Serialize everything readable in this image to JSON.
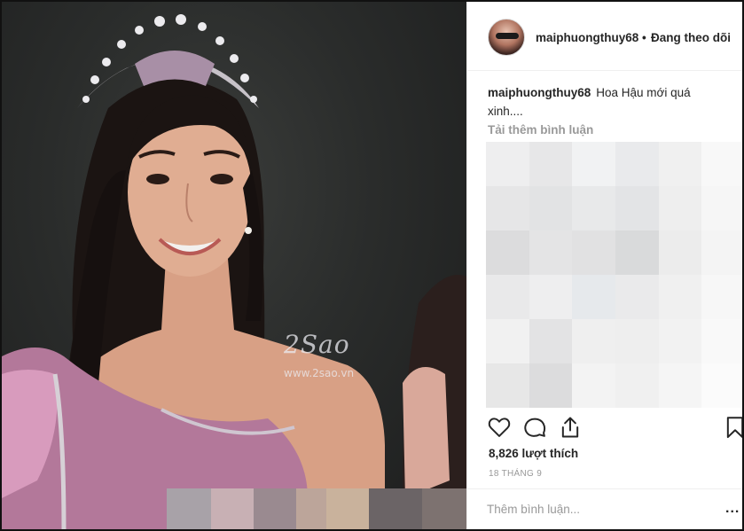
{
  "post": {
    "watermark_logo": "2Sao",
    "watermark_url": "www.2sao.vn",
    "image_censor_colors": [
      "#a8a2a8",
      "#c8b0b4",
      "#9a8a90",
      "#bca59a",
      "#c9b29c",
      "#6b6466",
      "#7d7270"
    ]
  },
  "header": {
    "username": "maiphuongthuy68",
    "separator": "•",
    "follow_status": "Đang theo dõi"
  },
  "caption": {
    "username": "maiphuongthuy68",
    "text": "Hoa Hậu mới quá xinh...."
  },
  "comments": {
    "load_more": "Tải thêm bình luận",
    "censor_colors": [
      "#eeeeef",
      "#e7e7e8",
      "#f1f2f3",
      "#e9eaec",
      "#f0f0f0",
      "#f8f8f8",
      "#e6e6e7",
      "#e2e3e4",
      "#e8e9ea",
      "#e3e4e6",
      "#eeeeee",
      "#f6f6f6",
      "#dcdcdd",
      "#e4e4e5",
      "#e1e1e2",
      "#d9dadb",
      "#ececec",
      "#f4f4f4",
      "#e9e9ea",
      "#eeeeef",
      "#e6e9ec",
      "#eaeaeb",
      "#f0f0f0",
      "#f7f7f7",
      "#f1f1f1",
      "#e3e3e4",
      "#efefef",
      "#eeeeee",
      "#f2f2f2",
      "#f9f9f9",
      "#e7e7e7",
      "#dcdcdd",
      "#f3f3f3",
      "#f0f0f0",
      "#f5f5f5",
      "#fbfbfb"
    ]
  },
  "actions": {
    "like_icon": "heart-icon",
    "comment_icon": "comment-icon",
    "share_icon": "share-icon",
    "save_icon": "bookmark-icon"
  },
  "stats": {
    "likes": "8,826 lượt thích",
    "date": "18 THÁNG 9"
  },
  "comment_box": {
    "placeholder": "Thêm bình luận...",
    "more_label": "..."
  }
}
